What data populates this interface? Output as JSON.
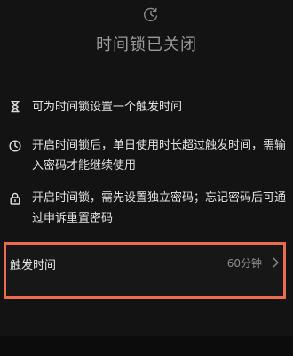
{
  "header": {
    "title": "时间锁已关闭",
    "icon": "time-lock-icon"
  },
  "info": [
    {
      "icon": "hourglass-icon",
      "text": "可为时间锁设置一个触发时间"
    },
    {
      "icon": "clock-icon",
      "text": "开启时间锁后，单日使用时长超过触发时间，需输入密码才能继续使用"
    },
    {
      "icon": "lock-icon",
      "text": "开启时间锁，需先设置独立密码；忘记密码后可通过申诉重置密码"
    }
  ],
  "trigger": {
    "label": "触发时间",
    "value": "60分钟",
    "icon": "chevron-right-icon"
  },
  "colors": {
    "background": "#131313",
    "highlight_border": "#ec6b4d",
    "primary_text": "#e2e2e2",
    "secondary_text": "#8c8c8c"
  }
}
